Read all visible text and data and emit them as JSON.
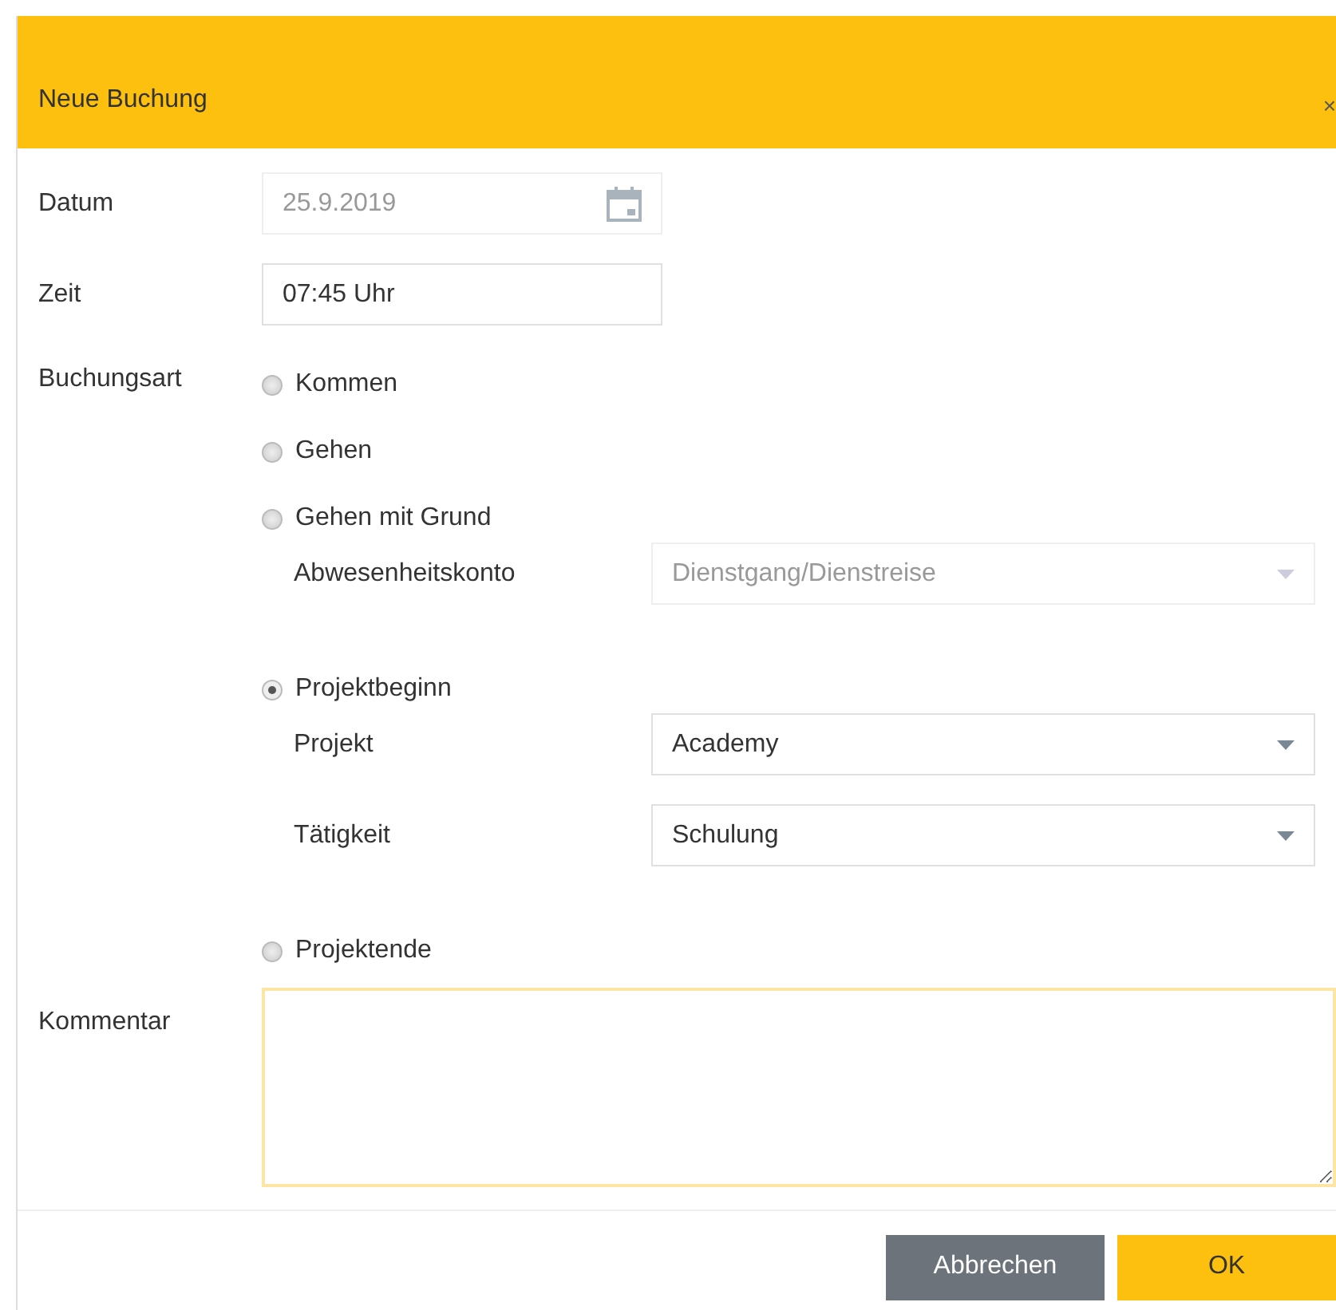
{
  "dialog": {
    "title": "Neue Buchung",
    "close": "×"
  },
  "date": {
    "label": "Datum",
    "value": "25.9.2019",
    "disabled": true
  },
  "time": {
    "label": "Zeit",
    "value": "07:45 Uhr",
    "disabled": false
  },
  "booking_type": {
    "label": "Buchungsart",
    "options": [
      {
        "label": "Kommen",
        "selected": false
      },
      {
        "label": "Gehen",
        "selected": false
      },
      {
        "label": "Gehen mit Grund",
        "selected": false,
        "fields": [
          {
            "label": "Abwesenheitskonto",
            "value": "Dienstgang/Dienstreise",
            "disabled": true
          }
        ]
      },
      {
        "label": "Projektbeginn",
        "selected": true,
        "fields": [
          {
            "label": "Projekt",
            "value": "Academy",
            "disabled": false
          },
          {
            "label": "Tätigkeit",
            "value": "Schulung",
            "disabled": false
          }
        ]
      },
      {
        "label": "Projektende",
        "selected": false
      }
    ]
  },
  "comment": {
    "label": "Kommentar",
    "focused": true
  },
  "buttons": [
    {
      "label": "Abbrechen",
      "kind": "secondary"
    },
    {
      "label": "OK",
      "kind": "primary"
    }
  ]
}
